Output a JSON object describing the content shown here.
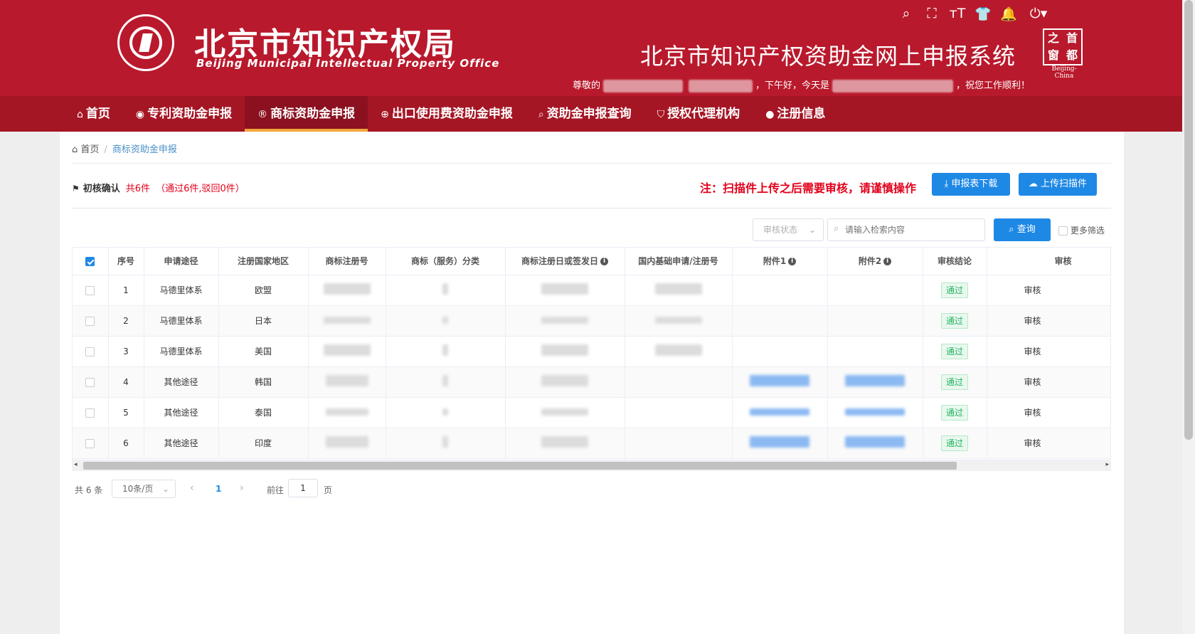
{
  "header": {
    "logo_cn": "北京市知识产权局",
    "logo_en": "Beijing Municipal Intellectual Property Office",
    "system_title": "北京市知识产权资助金网上申报系统",
    "city_logo": [
      "之",
      "首",
      "窗",
      "都"
    ],
    "city_caption": "Beijing-China",
    "greeting_prefix": "尊敬的",
    "greeting_mid": "，下午好，今天是",
    "greeting_suffix": "，祝您工作顺利！",
    "tools": [
      "search-icon",
      "fullscreen-icon",
      "font-size-icon",
      "theme-icon",
      "bell-icon",
      "power-icon"
    ]
  },
  "nav": [
    {
      "label": "首页",
      "icon": "⌂"
    },
    {
      "label": "专利资助金申报",
      "icon": "◉"
    },
    {
      "label": "商标资助金申报",
      "icon": "®",
      "active": true
    },
    {
      "label": "出口使用费资助金申报",
      "icon": "⊕"
    },
    {
      "label": "资助金申报查询",
      "icon": "⌕"
    },
    {
      "label": "授权代理机构",
      "icon": "⛉"
    },
    {
      "label": "注册信息",
      "icon": "●"
    }
  ],
  "breadcrumb": {
    "home": "首页",
    "current": "商标资助金申报"
  },
  "status": {
    "label": "初核确认",
    "count": "共6件",
    "detail": "（通过6件,驳回0件）"
  },
  "note": "注：扫描件上传之后需要审核，请谨慎操作",
  "buttons": {
    "download": "⤓ 申报表下载",
    "upload": "☁ 上传扫描件",
    "query": "⌕ 查询"
  },
  "filter": {
    "status_placeholder": "审核状态",
    "search_placeholder": "请输入检索内容",
    "more": "更多筛选"
  },
  "table": {
    "headers": [
      "序号",
      "申请途径",
      "注册国家地区",
      "商标注册号",
      "商标（服务）分类",
      "商标注册日或签发日",
      "国内基础申请/注册号",
      "附件1",
      "附件2",
      "审核结论",
      "审核"
    ],
    "rows": [
      {
        "no": "1",
        "route": "马德里体系",
        "country": "欧盟",
        "conclusion": "通过",
        "audit": "审核"
      },
      {
        "no": "2",
        "route": "马德里体系",
        "country": "日本",
        "conclusion": "通过",
        "audit": "审核"
      },
      {
        "no": "3",
        "route": "马德里体系",
        "country": "美国",
        "conclusion": "通过",
        "audit": "审核"
      },
      {
        "no": "4",
        "route": "其他途径",
        "country": "韩国",
        "conclusion": "通过",
        "audit": "审核"
      },
      {
        "no": "5",
        "route": "其他途径",
        "country": "泰国",
        "conclusion": "通过",
        "audit": "审核"
      },
      {
        "no": "6",
        "route": "其他途径",
        "country": "印度",
        "conclusion": "通过",
        "audit": "审核"
      }
    ]
  },
  "pagination": {
    "total": "共 6 条",
    "page_size": "10条/页",
    "current": "1",
    "goto_label": "前往",
    "goto_value": "1",
    "goto_unit": "页"
  }
}
